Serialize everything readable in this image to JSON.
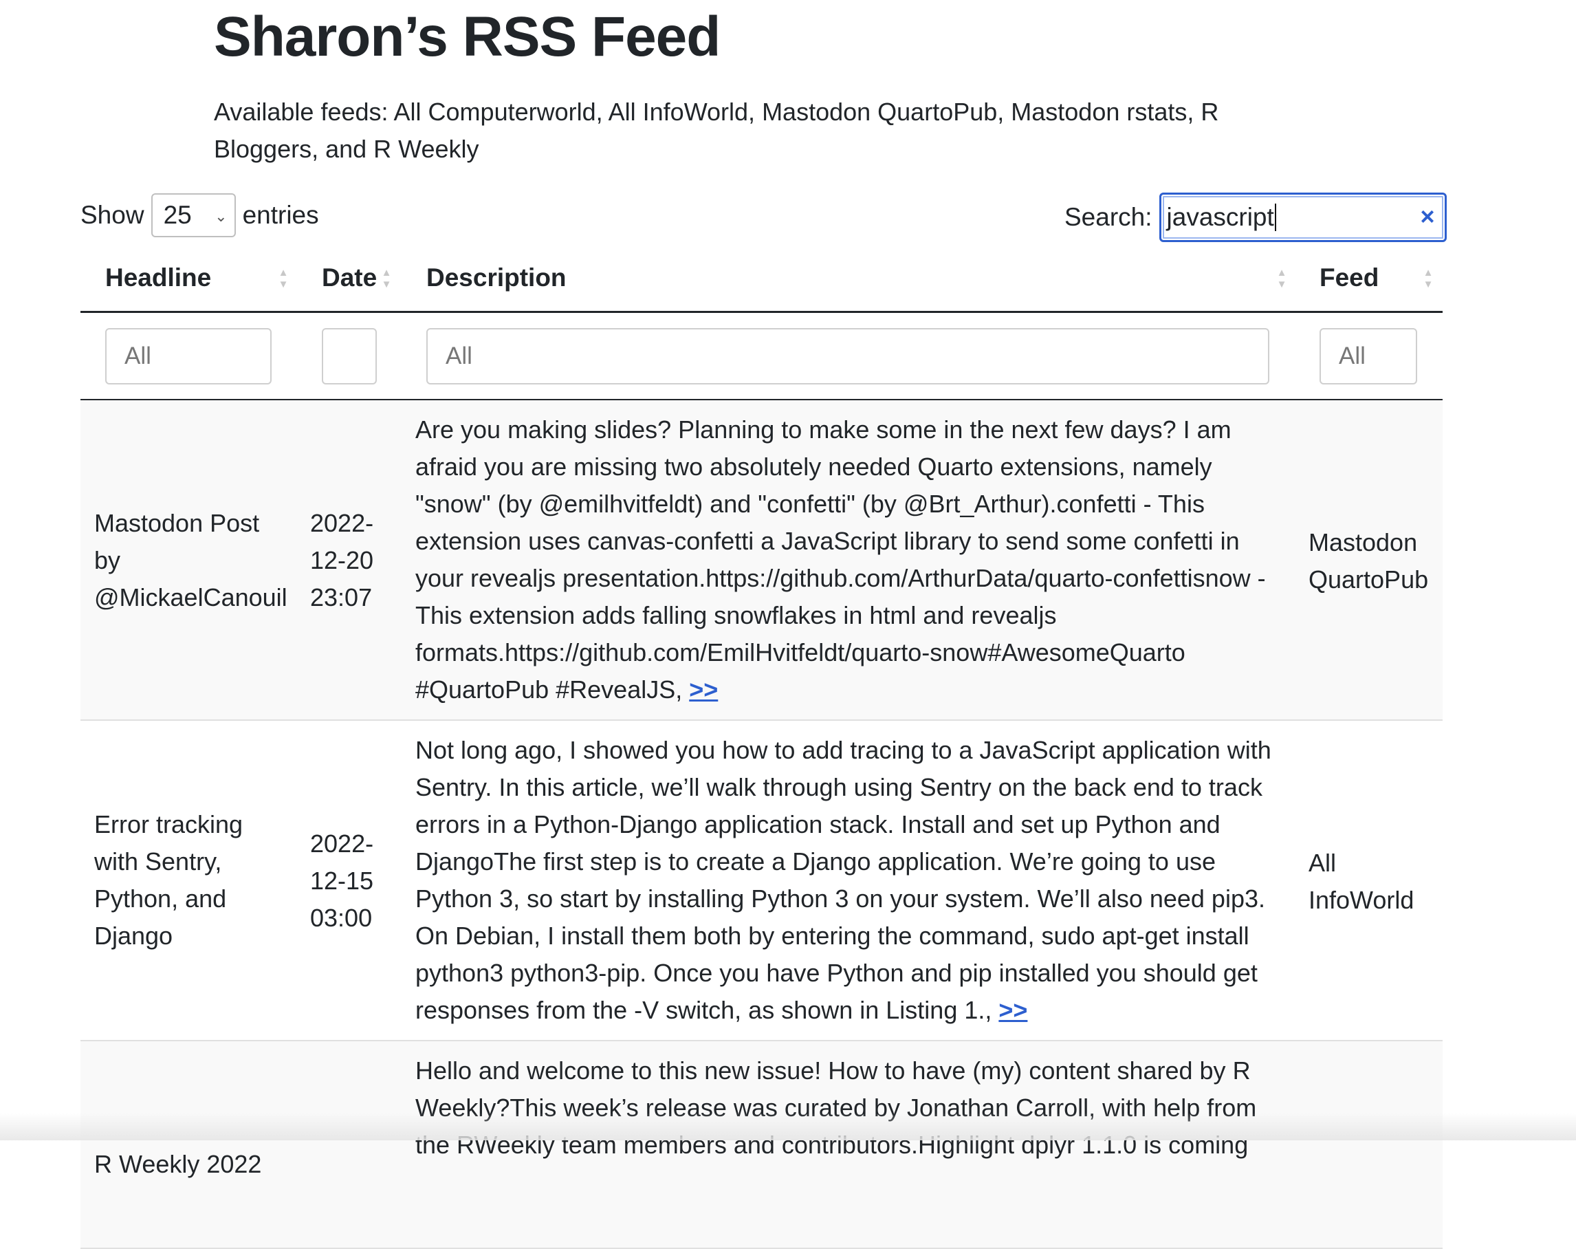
{
  "page": {
    "title": "Sharon’s RSS Feed",
    "feeds_text": "Available feeds: All Computerworld, All InfoWorld, Mastodon QuartoPub, Mastodon rstats, R Bloggers, and R Weekly"
  },
  "controls": {
    "show_label": "Show",
    "entries_value": "25",
    "entries_label": "entries",
    "search_label": "Search:",
    "search_value": "javascript",
    "clear_icon": "×",
    "select_chevron": "⌄"
  },
  "table": {
    "headers": {
      "headline": "Headline",
      "date": "Date",
      "description": "Description",
      "feed": "Feed"
    },
    "filters": {
      "headline": "All",
      "date": "",
      "description": "All",
      "feed": "All"
    },
    "rows": [
      {
        "headline": "Mastodon Post by @MickaelCanouil",
        "date": "2022-12-20 23:07",
        "description": "Are you making slides? Planning to make some in the next few days? I am afraid you are missing two absolutely needed Quarto extensions, namely \"snow\" (by @emilhvitfeldt) and \"confetti\" (by @Brt_Arthur).confetti - This extension uses canvas-confetti a JavaScript library to send some confetti in your revealjs presentation.https://github.com/ArthurData/quarto-confettisnow - This extension adds falling snowflakes in html and revealjs formats.https://github.com/EmilHvitfeldt/quarto-snow#AwesomeQuarto #QuartoPub #RevealJS, ",
        "link_text": ">>",
        "feed": "Mastodon QuartoPub"
      },
      {
        "headline": "Error tracking with Sentry, Python, and Django",
        "date": "2022-12-15 03:00",
        "description": "Not long ago, I showed you how to add tracing to a JavaScript application with Sentry. In this article, we’ll walk through using Sentry on the back end to track errors in a Python-Django application stack. Install and set up Python and DjangoThe first step is to create a Django application. We’re going to use Python 3, so start by installing Python 3 on your system. We’ll also need pip3. On Debian, I install them both by entering the command, sudo apt-get install python3 python3-pip. Once you have Python and pip installed you should get responses from the -V switch, as shown in Listing 1., ",
        "link_text": ">>",
        "feed": "All InfoWorld"
      },
      {
        "headline": "R Weekly 2022",
        "date": "",
        "description": "Hello and welcome to this new issue! How to have (my) content shared by R Weekly?This week’s release was curated by Jonathan Carroll, with help from the RWeekly team members and contributors.Highlight dplyr 1.1.0 is coming",
        "link_text": "",
        "feed": ""
      }
    ]
  }
}
